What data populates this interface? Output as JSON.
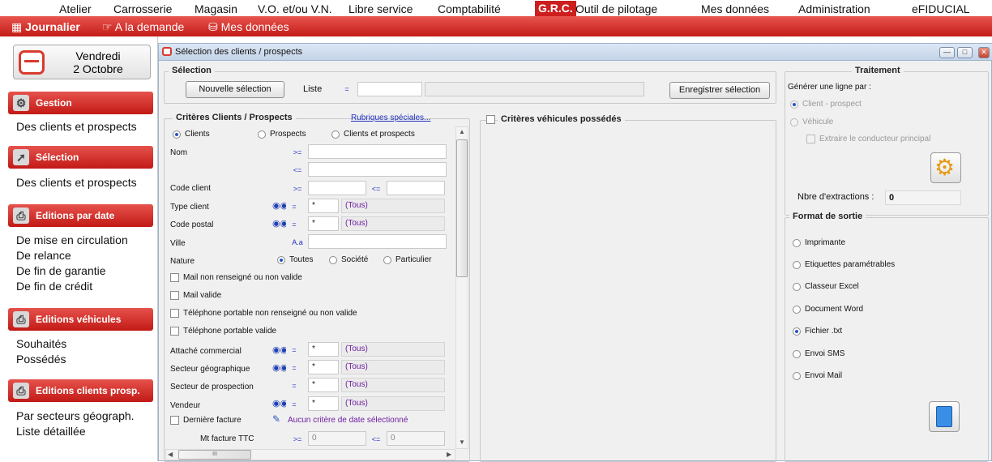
{
  "top_menu": [
    "Atelier",
    "Carrosserie",
    "Magasin",
    "V.O. et/ou V.N.",
    "Libre service",
    "Comptabilité",
    "G.R.C.",
    "Outil de pilotage",
    "Mes données",
    "Administration",
    "eFIDUCIAL"
  ],
  "sub_menu": {
    "journalier": "Journalier",
    "a_la_demande": "A la demande",
    "mes_donnees": "Mes données"
  },
  "date": {
    "day": "Vendredi",
    "date": "2 Octobre"
  },
  "sidebar": {
    "gestion": {
      "title": "Gestion",
      "links": [
        "Des clients et prospects"
      ]
    },
    "selection": {
      "title": "Sélection",
      "links": [
        "Des clients et prospects"
      ]
    },
    "editions_date": {
      "title": "Editions par date",
      "links": [
        "De mise en circulation",
        "De relance",
        "De fin de garantie",
        "De fin de crédit"
      ]
    },
    "editions_vehicules": {
      "title": "Editions véhicules",
      "links": [
        "Souhaités",
        "Possédés"
      ]
    },
    "editions_clients": {
      "title": "Editions clients prosp.",
      "links": [
        "Par secteurs géograph.",
        "Liste détaillée"
      ]
    }
  },
  "window": {
    "title": "Sélection des clients / prospects"
  },
  "selection": {
    "group": "Sélection",
    "new_button": "Nouvelle sélection",
    "liste_label": "Liste",
    "op": "=",
    "save_button": "Enregistrer sélection"
  },
  "criteres": {
    "group": "Critères Clients / Prospects",
    "special_link": "Rubriques spéciales...",
    "type_radios": [
      "Clients",
      "Prospects",
      "Clients et prospects"
    ],
    "nom": "Nom",
    "code_client": "Code client",
    "type_client": "Type client",
    "code_postal": "Code postal",
    "ville": "Ville",
    "nature": "Nature",
    "nature_radios": [
      "Toutes",
      "Société",
      "Particulier"
    ],
    "mail_non": "Mail non renseigné ou non valide",
    "mail_valide": "Mail valide",
    "tel_non": "Téléphone portable non renseigné ou non valide",
    "tel_valide": "Téléphone portable valide",
    "attache": "Attaché commercial",
    "secteur_geo": "Secteur géographique",
    "secteur_prosp": "Secteur de prospection",
    "vendeur": "Vendeur",
    "derniere_facture": "Dernière facture",
    "aucun_critere": "Aucun critère de date sélectionné",
    "mt_facture": "Mt facture TTC",
    "op_ge": ">=",
    "op_le": "<=",
    "op_eq": "=",
    "op_aa": "A.a",
    "star": "*",
    "tous": "(Tous)",
    "zero": "0",
    "scroll_dots": "III"
  },
  "vehicules": {
    "label": "Critères véhicules possédés"
  },
  "traitement": {
    "group": "Traitement",
    "generer": "Générer une ligne par :",
    "client_prospect": "Client - prospect",
    "vehicule": "Véhicule",
    "extraire": "Extraire le conducteur principal",
    "nbre_label": "Nbre d'extractions :",
    "nbre_value": "0"
  },
  "format": {
    "group": "Format de sortie",
    "options": [
      "Imprimante",
      "Etiquettes paramétrables",
      "Classeur Excel",
      "Document Word",
      "Fichier .txt",
      "Envoi SMS",
      "Envoi Mail"
    ]
  },
  "colors": {
    "accent": "#cc1e1e",
    "link": "#2030c0",
    "tous": "#6d1fa0"
  }
}
